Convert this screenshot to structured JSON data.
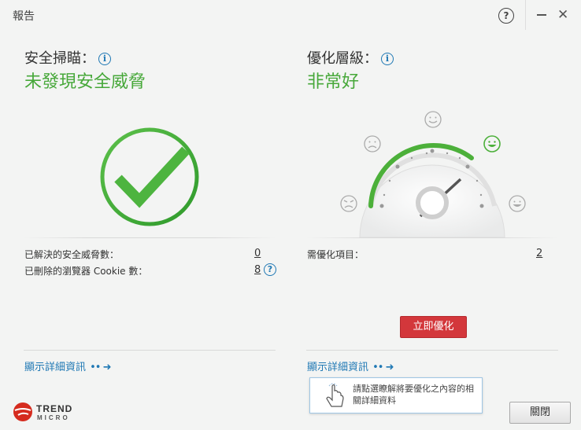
{
  "window": {
    "title": "報告"
  },
  "security": {
    "heading": "安全掃瞄：",
    "status": "未發現安全威脅",
    "rows": [
      {
        "label": "已解決的安全威脅數：",
        "value": "0"
      },
      {
        "label": "已刪除的瀏覽器 Cookie 數：",
        "value": "8"
      }
    ],
    "details_link": "顯示詳細資訊"
  },
  "optimization": {
    "heading": "優化層級：",
    "status": "非常好",
    "gauge_level": 0.75,
    "rows": [
      {
        "label": "需優化項目：",
        "value": "2"
      }
    ],
    "optimize_button": "立即優化",
    "details_link": "顯示詳細資訊",
    "tooltip": "請點選瞭解將要優化之內容的相關詳細資料"
  },
  "footer": {
    "brand_line1": "TREND",
    "brand_line2": "MICRO",
    "close_button": "關閉"
  },
  "colors": {
    "accent_green": "#47a83a",
    "link_blue": "#1f78b4",
    "action_red": "#d3373b"
  },
  "icons": [
    "help-icon",
    "minimize-icon",
    "close-icon",
    "info-icon",
    "checkmark-icon",
    "gauge-icon",
    "face-icons",
    "arrow-right-icon",
    "hand-pointer-icon",
    "trend-micro-logo"
  ]
}
